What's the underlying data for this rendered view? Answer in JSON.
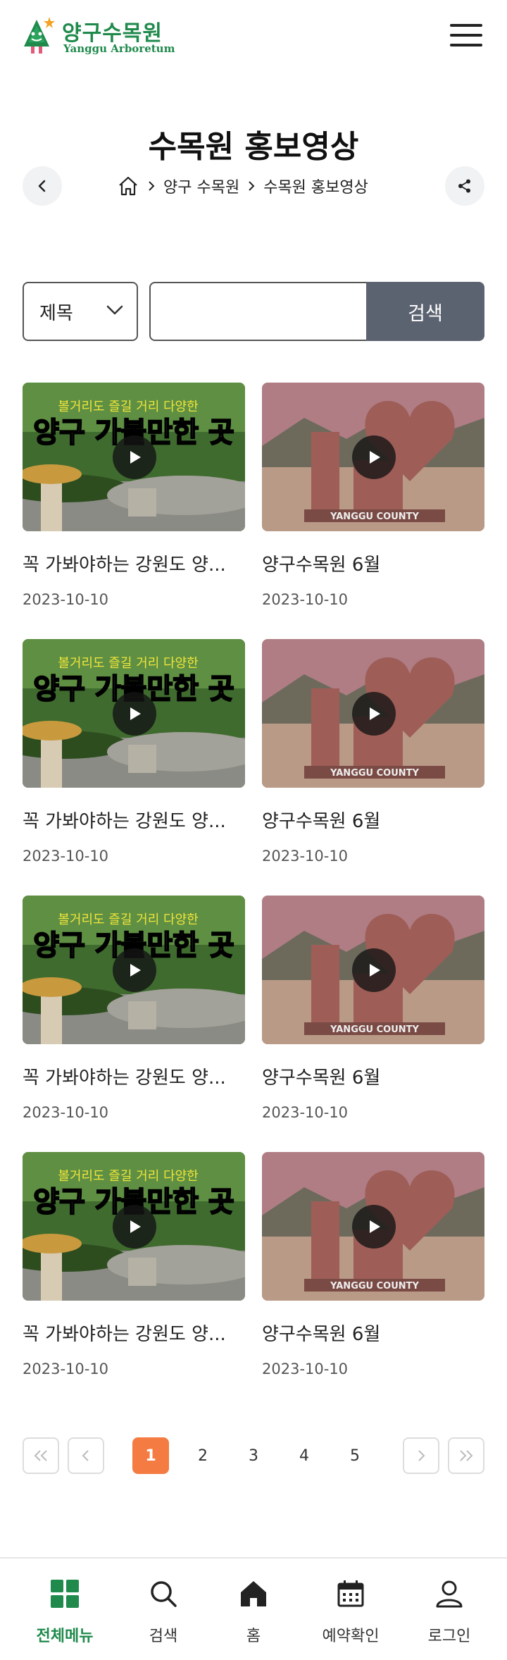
{
  "header": {
    "logo_ko": "양구수목원",
    "logo_en": "Yanggu Arboretum"
  },
  "page": {
    "title": "수목원 홍보영상"
  },
  "breadcrumb": {
    "items": [
      "양구 수목원",
      "수목원 홍보영상"
    ]
  },
  "search": {
    "select_value": "제목",
    "input_value": "",
    "input_placeholder": "",
    "button_label": "검색"
  },
  "videos": [
    {
      "title": "꼭 가봐야하는 강원도 양...",
      "date": "2023-10-10",
      "thumb": "mushroom",
      "thumb_caption_top": "볼거리도 즐길 거리 다양한",
      "thumb_caption_main": "양구 가볼만한 곳"
    },
    {
      "title": "양구수목원 6월",
      "date": "2023-10-10",
      "thumb": "sign",
      "thumb_caption_main": "YANGGU COUNTY"
    },
    {
      "title": "꼭 가봐야하는 강원도 양...",
      "date": "2023-10-10",
      "thumb": "mushroom",
      "thumb_caption_top": "볼거리도 즐길 거리 다양한",
      "thumb_caption_main": "양구 가볼만한 곳"
    },
    {
      "title": "양구수목원 6월",
      "date": "2023-10-10",
      "thumb": "sign",
      "thumb_caption_main": "YANGGU COUNTY"
    },
    {
      "title": "꼭 가봐야하는 강원도 양...",
      "date": "2023-10-10",
      "thumb": "mushroom",
      "thumb_caption_top": "볼거리도 즐길 거리 다양한",
      "thumb_caption_main": "양구 가볼만한 곳"
    },
    {
      "title": "양구수목원 6월",
      "date": "2023-10-10",
      "thumb": "sign",
      "thumb_caption_main": "YANGGU COUNTY"
    },
    {
      "title": "꼭 가봐야하는 강원도 양...",
      "date": "2023-10-10",
      "thumb": "mushroom",
      "thumb_caption_top": "볼거리도 즐길 거리 다양한",
      "thumb_caption_main": "양구 가볼만한 곳"
    },
    {
      "title": "양구수목원 6월",
      "date": "2023-10-10",
      "thumb": "sign",
      "thumb_caption_main": "YANGGU COUNTY"
    }
  ],
  "pagination": {
    "pages": [
      "1",
      "2",
      "3",
      "4",
      "5"
    ],
    "current": "1"
  },
  "bottom_nav": {
    "items": [
      {
        "label": "전체메뉴",
        "icon": "grid-icon",
        "active": true
      },
      {
        "label": "검색",
        "icon": "search-icon",
        "active": false
      },
      {
        "label": "홈",
        "icon": "home-icon",
        "active": false
      },
      {
        "label": "예약확인",
        "icon": "calendar-icon",
        "active": false
      },
      {
        "label": "로그인",
        "icon": "user-icon",
        "active": false
      }
    ]
  },
  "colors": {
    "brand_green": "#1f8a4c",
    "accent_orange": "#f47c42",
    "search_button": "#5c6370"
  }
}
